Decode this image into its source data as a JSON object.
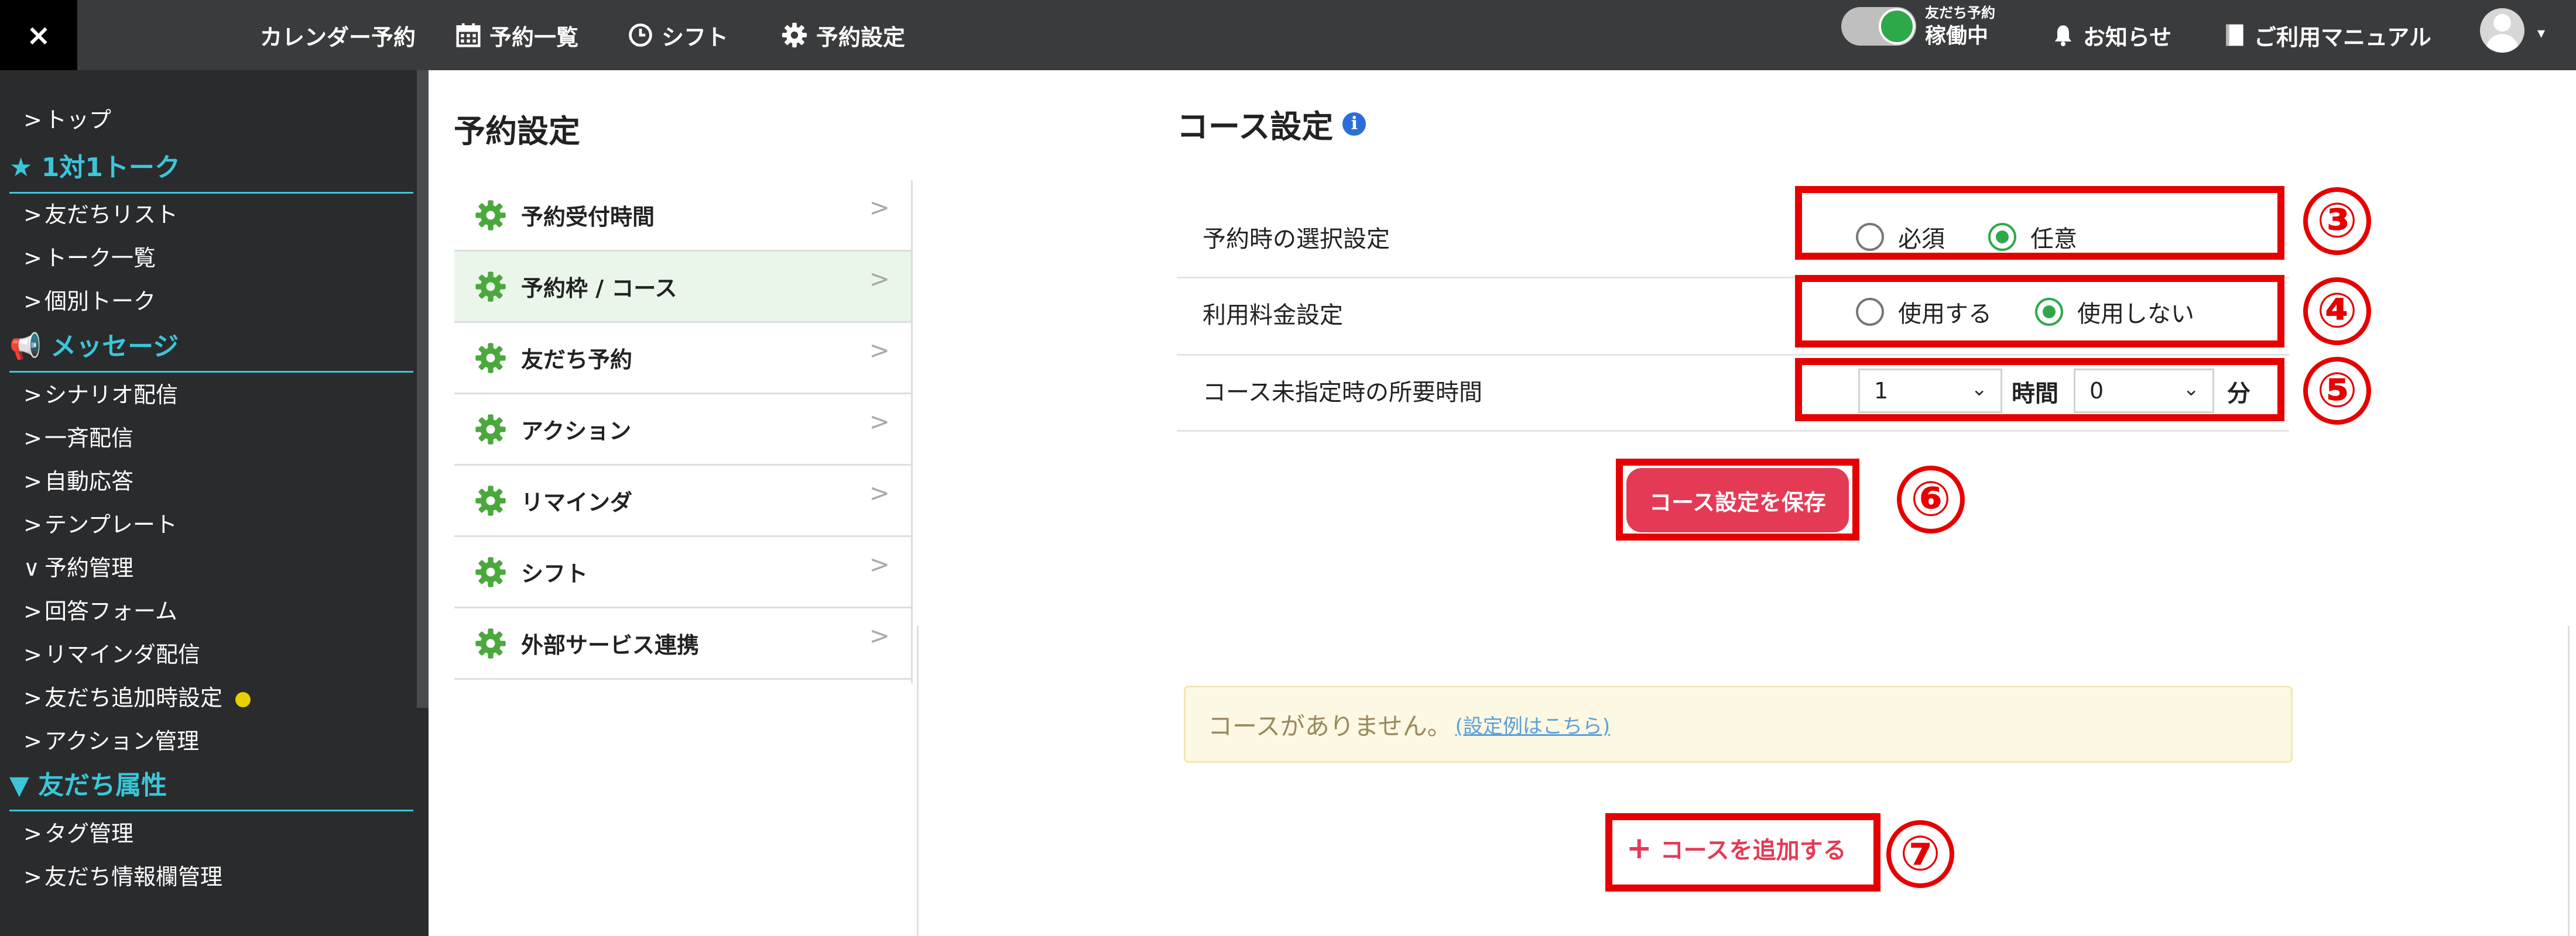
{
  "topbar": {
    "close_icon": "×",
    "nav": [
      "カレンダー予約",
      "予約一覧",
      "シフト",
      "予約設定"
    ],
    "status_small": "友だち予約",
    "status_big": "稼働中",
    "notifications": "お知らせ",
    "manual": "ご利用マニュアル",
    "caret": "▾"
  },
  "sidebar": {
    "items": [
      {
        "type": "item",
        "chev": ">",
        "label": "トップ"
      },
      {
        "type": "head",
        "icon": "★",
        "label": "1対1トーク"
      },
      {
        "type": "item",
        "chev": ">",
        "label": "友だちリスト"
      },
      {
        "type": "item",
        "chev": ">",
        "label": "トーク一覧"
      },
      {
        "type": "item",
        "chev": ">",
        "label": "個別トーク"
      },
      {
        "type": "head",
        "icon": "📢",
        "label": "メッセージ"
      },
      {
        "type": "item",
        "chev": ">",
        "label": "シナリオ配信"
      },
      {
        "type": "item",
        "chev": ">",
        "label": "一斉配信"
      },
      {
        "type": "item",
        "chev": ">",
        "label": "自動応答"
      },
      {
        "type": "item",
        "chev": ">",
        "label": "テンプレート"
      },
      {
        "type": "item",
        "chev": "∨",
        "label": "予約管理"
      },
      {
        "type": "item",
        "chev": ">",
        "label": "回答フォーム"
      },
      {
        "type": "item",
        "chev": ">",
        "label": "リマインダ配信"
      },
      {
        "type": "item",
        "chev": ">",
        "label": "友だち追加時設定"
      },
      {
        "type": "item",
        "chev": ">",
        "label": "アクション管理"
      },
      {
        "type": "head",
        "icon": "▼",
        "label": "友だち属性"
      },
      {
        "type": "item",
        "chev": ">",
        "label": "タグ管理"
      },
      {
        "type": "item",
        "chev": ">",
        "label": "友だち情報欄管理"
      }
    ]
  },
  "settings_menu": {
    "title": "予約設定",
    "chevron": ">",
    "items": [
      "予約受付時間",
      "予約枠 / コース",
      "友だち予約",
      "アクション",
      "リマインダ",
      "シフト",
      "外部サービス連携"
    ],
    "active_index": 1
  },
  "course": {
    "title": "コース設定",
    "info_icon": "i",
    "selection_label": "予約時の選択設定",
    "selection_options": [
      "必須",
      "任意"
    ],
    "selection_value": "任意",
    "fee_label": "利用料金設定",
    "fee_options": [
      "使用する",
      "使用しない"
    ],
    "fee_value": "使用しない",
    "duration_label": "コース未指定時の所要時間",
    "hours_value": "1",
    "hours_unit": "時間",
    "minutes_value": "0",
    "minutes_unit": "分",
    "save_label": "コース設定を保存",
    "empty_message": "コースがありません。",
    "example_link": "(設定例はこちら)",
    "add_label": "コースを追加する",
    "add_icon": "+"
  },
  "annotations": [
    "③",
    "④",
    "⑤",
    "⑥",
    "⑦"
  ],
  "colors": {
    "accent_red": "#e60000",
    "button": "#e43a55",
    "toggle_on": "#2fa84a",
    "sidebar_head": "#3cc6d8"
  }
}
